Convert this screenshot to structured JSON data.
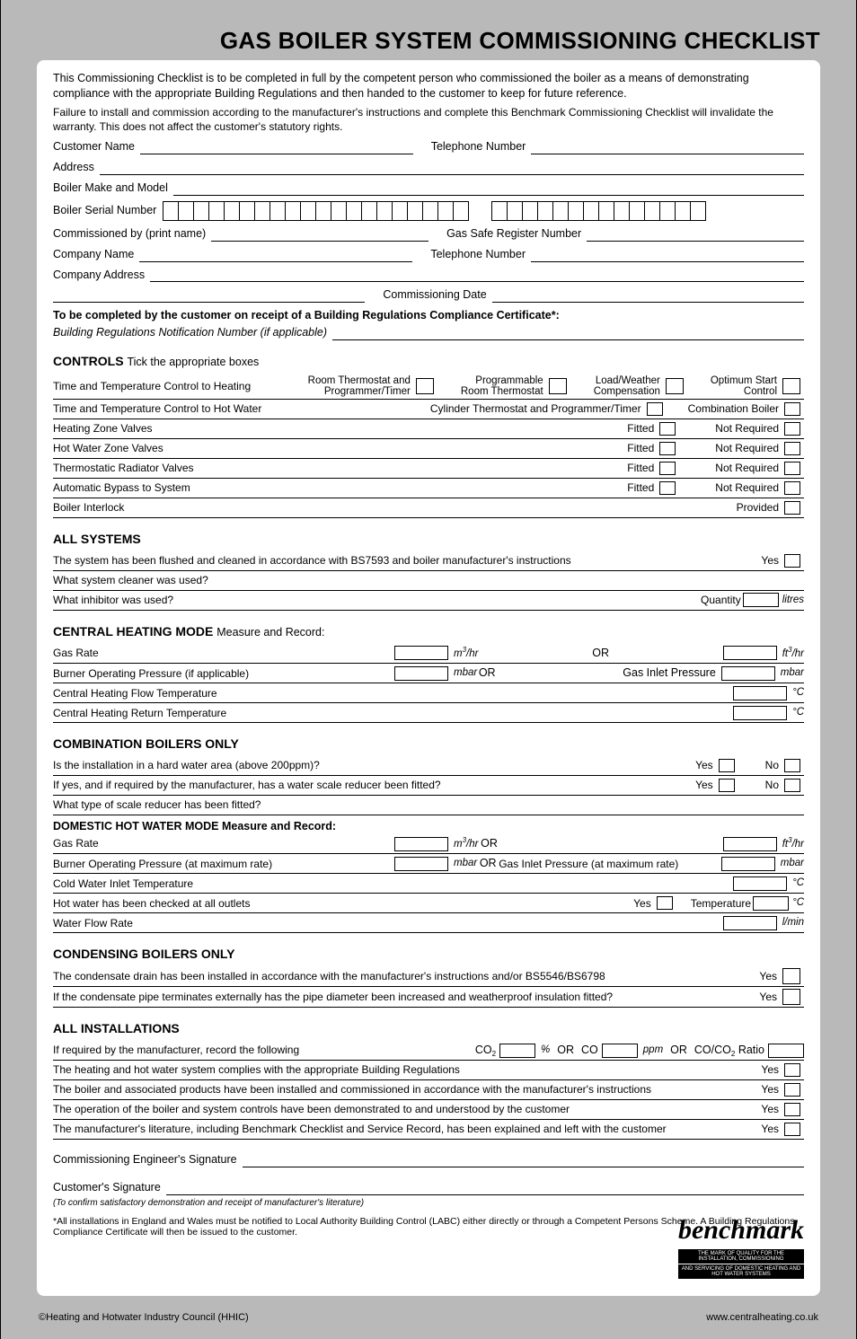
{
  "title": "GAS BOILER SYSTEM COMMISSIONING CHECKLIST",
  "intro": {
    "p1": "This Commissioning Checklist is to be completed in full by the competent person who commissioned the boiler as a means of demonstrating compliance with the appropriate Building Regulations and then handed to the customer to keep for future reference.",
    "p2": "Failure to install and commission according to the manufacturer's instructions and complete this Benchmark Commissioning Checklist will invalidate the warranty. This does not affect the customer's statutory rights."
  },
  "fields": {
    "customer_name": "Customer Name",
    "telephone_number": "Telephone Number",
    "address": "Address",
    "boiler_make_model": "Boiler Make and Model",
    "boiler_serial_number": "Boiler Serial Number",
    "commissioned_by": "Commissioned by (print name)",
    "gas_safe_register_number": "Gas Safe Register Number",
    "company_name": "Company Name",
    "company_address": "Company Address",
    "commissioning_date": "Commissioning Date",
    "to_be_completed": "To be completed by the customer on receipt of a Building Regulations Compliance Certificate*:",
    "brnn": "Building Regulations Notification Number (if applicable)"
  },
  "controls": {
    "heading": "CONTROLS",
    "heading_sub": "Tick the appropriate boxes",
    "ttc_heating": "Time and Temperature Control to Heating",
    "opt1a": "Room Thermostat and",
    "opt1b": "Programmer/Timer",
    "opt2a": "Programmable",
    "opt2b": "Room Thermostat",
    "opt3a": "Load/Weather",
    "opt3b": "Compensation",
    "opt4a": "Optimum Start",
    "opt4b": "Control",
    "ttc_hw": "Time and Temperature Control to Hot Water",
    "ctpt": "Cylinder Thermostat and Programmer/Timer",
    "comb_boiler": "Combination Boiler",
    "hzv": "Heating Zone Valves",
    "hwzv": "Hot Water Zone Valves",
    "trv": "Thermostatic Radiator Valves",
    "abs": "Automatic Bypass to System",
    "fitted": "Fitted",
    "not_required": "Not Required",
    "interlock": "Boiler Interlock",
    "provided": "Provided"
  },
  "allsystems": {
    "heading": "ALL SYSTEMS",
    "flushed": "The system has been flushed and cleaned in accordance with BS7593 and boiler manufacturer's instructions",
    "yes": "Yes",
    "cleaner": "What system cleaner was used?",
    "inhibitor": "What inhibitor was used?",
    "quantity": "Quantity",
    "litres": "litres"
  },
  "chm": {
    "heading": "CENTRAL HEATING MODE",
    "heading_sub": "Measure and Record:",
    "gas_rate": "Gas Rate",
    "m3hr": "m³/hr",
    "or": "OR",
    "ft3hr": "ft³/hr",
    "bop": "Burner Operating Pressure (if applicable)",
    "mbar": "mbar",
    "gip": "Gas Inlet Pressure",
    "chft": "Central Heating Flow Temperature",
    "chrt": "Central Heating Return Temperature",
    "degc": "°C"
  },
  "combi": {
    "heading": "COMBINATION BOILERS ONLY",
    "hard": "Is the installation in a hard water area (above 200ppm)?",
    "scale": "If yes, and if required by the manufacturer, has a water scale reducer been fitted?",
    "yes": "Yes",
    "no": "No",
    "type": "What type of scale reducer has been fitted?",
    "dhw_head": "DOMESTIC HOT WATER MODE Measure and Record:",
    "gas_rate": "Gas Rate",
    "bop_max": "Burner Operating Pressure (at maximum rate)",
    "gip_max": "Gas Inlet Pressure (at maximum rate)",
    "cwit": "Cold Water Inlet Temperature",
    "hwchecked": "Hot water has been checked at all outlets",
    "temperature": "Temperature",
    "wfr": "Water Flow Rate",
    "lmin": "l/min"
  },
  "cond": {
    "heading": "CONDENSING BOILERS ONLY",
    "drain": "The condensate drain has been installed in accordance with the manufacturer's instructions and/or BS5546/BS6798",
    "ext": "If the condensate pipe terminates externally has the pipe diameter been increased and weatherproof insulation fitted?",
    "yes": "Yes"
  },
  "allinst": {
    "heading": "ALL INSTALLATIONS",
    "record": "If required by the manufacturer, record the following",
    "co2": "CO₂",
    "pct": "%",
    "or": "OR",
    "co": "CO",
    "ppm": "ppm",
    "ratio": "CO/CO₂ Ratio",
    "complies": "The heating and hot water system complies with the appropriate Building Regulations",
    "installed": "The boiler and associated products have been installed and commissioned in accordance with the manufacturer's instructions",
    "demo": "The operation of the boiler and system controls have been demonstrated to and understood by the customer",
    "lit": "The manufacturer's literature, including Benchmark Checklist and Service Record, has been explained and left with the customer",
    "yes": "Yes"
  },
  "sig": {
    "eng": "Commissioning Engineer's Signature",
    "cust": "Customer's Signature",
    "confirm": "(To confirm satisfactory demonstration and receipt of manufacturer's literature)"
  },
  "asterisk": "*All installations in England and Wales must be notified to Local Authority Building Control (LABC) either directly or through a Competent Persons Scheme. A Building Regulations Compliance Certificate will then be issued to the customer.",
  "benchmark": {
    "logo": "benchmark",
    "sub1": "THE MARK OF QUALITY FOR THE INSTALLATION, COMMISSIONING",
    "sub2": "AND SERVICING OF DOMESTIC HEATING AND HOT WATER SYSTEMS"
  },
  "footer": {
    "left": "©Heating and Hotwater Industry Council (HHIC)",
    "right": "www.centralheating.co.uk"
  }
}
